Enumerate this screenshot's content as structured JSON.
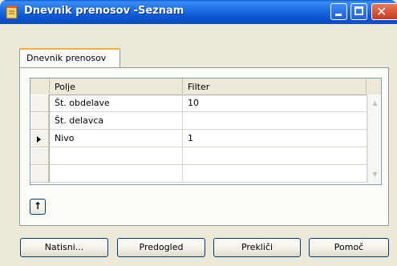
{
  "window": {
    "title": "Dnevnik prenosov -Seznam"
  },
  "tabs": [
    {
      "label": "Dnevnik prenosov"
    }
  ],
  "grid": {
    "columns": [
      "Polje",
      "Filter"
    ],
    "rows": [
      {
        "polje": "Št. obdelave",
        "filter": "10",
        "current": false
      },
      {
        "polje": "Št. delavca",
        "filter": "",
        "current": false
      },
      {
        "polje": "Nivo",
        "filter": "1",
        "current": true
      },
      {
        "polje": "",
        "filter": "",
        "current": false
      },
      {
        "polje": "",
        "filter": "",
        "current": false
      }
    ]
  },
  "buttons": {
    "print": "Natisni...",
    "preview": "Predogled",
    "cancel": "Prekliči",
    "help": "Pomoč"
  },
  "icons": {
    "title": "window-document-icon",
    "minimize": "minimize-icon",
    "maximize": "maximize-icon",
    "close": "close-icon",
    "up": "arrow-up-icon"
  },
  "colors": {
    "titlebar": "#0a5fd8",
    "close": "#c53c1a",
    "tab_accent": "#f4b23c"
  }
}
